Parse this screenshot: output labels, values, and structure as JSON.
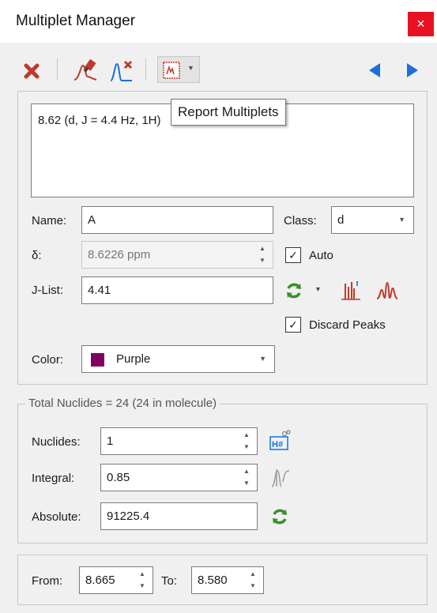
{
  "window": {
    "title": "Multiplet Manager",
    "close_glyph": "×"
  },
  "toolbar": {
    "icons": [
      "delete-icon",
      "pick-multiplet-icon",
      "remove-multiplet-peak-icon",
      "report-multiplets-icon",
      "previous-arrow-icon",
      "next-arrow-icon"
    ],
    "tooltip": "Report Multiplets"
  },
  "report": {
    "text": "8.62 (d, J = 4.4 Hz, 1H)"
  },
  "form": {
    "name_label": "Name:",
    "name_value": "A",
    "class_label": "Class:",
    "class_value": "d",
    "delta_label": "δ:",
    "delta_value": "8.6226 ppm",
    "auto_label": "Auto",
    "auto_checked": true,
    "jlist_label": "J-List:",
    "jlist_value": "4.41",
    "discard_label": "Discard Peaks",
    "discard_checked": true,
    "color_label": "Color:",
    "color_value": "Purple",
    "color_swatch": "#800060"
  },
  "nuclides": {
    "caption": "Total Nuclides = 24 (24 in molecule)",
    "nuclides_label": "Nuclides:",
    "nuclides_value": "1",
    "integral_label": "Integral:",
    "integral_value": "0.85",
    "absolute_label": "Absolute:",
    "absolute_value": "91225.4"
  },
  "range": {
    "from_label": "From:",
    "from_value": "8.665",
    "to_label": "To:",
    "to_value": "8.580"
  },
  "colors": {
    "close": "#e81123",
    "accent_blue": "#1c6fd6",
    "red": "#c0392b",
    "green": "#3a8f2a"
  }
}
